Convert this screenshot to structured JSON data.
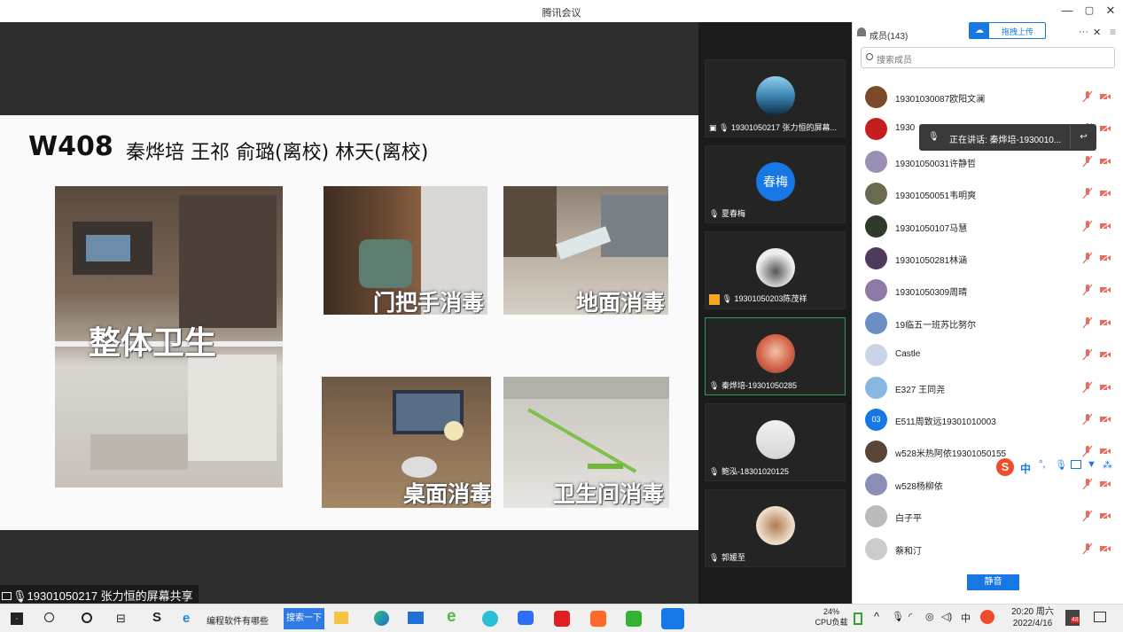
{
  "window": {
    "title": "腾讯会议",
    "minimize": "—",
    "restore": "▢",
    "close": "✕"
  },
  "slide": {
    "title": "W408",
    "names": "秦烨培  王祁  俞璐(离校)  林天(离校)",
    "captions": [
      "整体卫生",
      "门把手消毒",
      "地面消毒",
      "桌面消毒",
      "卫生间消毒"
    ]
  },
  "share_label": "19301050217 张力恒的屏幕共享",
  "thumbnails": [
    {
      "name": "19301050217 张力恒的屏幕..."
    },
    {
      "name": "夏春梅",
      "avatar_text": "春梅"
    },
    {
      "name": "19301050203陈茂祥"
    },
    {
      "name": "秦烨培-19301050285"
    },
    {
      "name": "鲍泓-18301020125"
    },
    {
      "name": "郭媛至"
    }
  ],
  "panel": {
    "members_label": "成员(143)",
    "upload_label": "拖拽上传",
    "more": "···",
    "close": "✕",
    "menu": "≡",
    "search_placeholder": "搜索成员",
    "speaking_label": "正在讲话: 秦烨培-1930010...",
    "mute_all": "静音",
    "members": [
      {
        "name": "19301030087欧阳文澜"
      },
      {
        "name": "1930"
      },
      {
        "name": "19301050031许静哲"
      },
      {
        "name": "19301050051韦明爽"
      },
      {
        "name": "19301050107马慧"
      },
      {
        "name": "19301050281林涵"
      },
      {
        "name": "19301050309周晴"
      },
      {
        "name": "19临五一班苏比努尔"
      },
      {
        "name": "Castle"
      },
      {
        "name": "E327 王同尧"
      },
      {
        "name": "E511周致远19301010003",
        "avatar_text": "03"
      },
      {
        "name": "w528米热阿依19301050155"
      },
      {
        "name": "w528杨柳依"
      },
      {
        "name": "白子平"
      },
      {
        "name": "蔡和汀"
      }
    ]
  },
  "ime": {
    "lang": "中"
  },
  "taskbar": {
    "browser_tab": "编程软件有哪些",
    "search_btn": "搜索一下",
    "cpu_percent": "24%",
    "cpu_label": "CPU负载",
    "time": "20:20 周六",
    "date": "2022/4/16",
    "mail_badge": "48"
  },
  "colors": {
    "accent": "#1677e5",
    "active_border": "#2d9a55",
    "tooltip_bg": "#3a3a3a"
  }
}
